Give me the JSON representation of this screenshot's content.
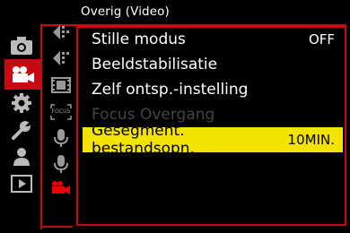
{
  "title": "Overig (Video)",
  "colors": {
    "accent": "#c80812",
    "highlight": "#f3e300",
    "disabled": "#444444"
  },
  "categories": [
    {
      "icon": "camera-icon",
      "active": false
    },
    {
      "icon": "video-camera-icon",
      "active": true
    },
    {
      "icon": "gear-icon",
      "active": false
    },
    {
      "icon": "wrench-icon",
      "active": false
    },
    {
      "icon": "person-icon",
      "active": false
    },
    {
      "icon": "playback-icon",
      "active": false
    }
  ],
  "sub_icons": [
    "exposure-icon",
    "exposure-alt-icon",
    "film-icon",
    "focus-icon",
    "microphone-icon",
    "microphone-alt-icon",
    "video-camera-small-icon"
  ],
  "sub_icon_focus_text": "FOCUS",
  "menu": [
    {
      "label": "Stille modus",
      "value": "OFF",
      "state": "normal"
    },
    {
      "label": "Beeldstabilisatie",
      "value": "",
      "state": "normal"
    },
    {
      "label": "Zelf ontsp.-instelling",
      "value": "",
      "state": "normal"
    },
    {
      "label": "Focus Overgang",
      "value": "",
      "state": "disabled"
    },
    {
      "label": "Gesegment. bestandsopn.",
      "value": "10MIN.",
      "state": "selected"
    }
  ]
}
